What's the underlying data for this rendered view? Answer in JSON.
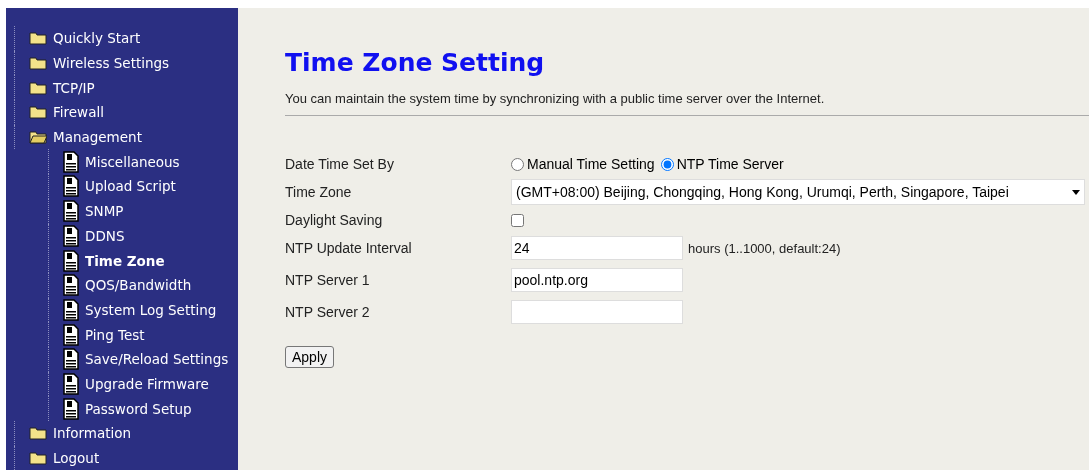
{
  "sidebar": {
    "items": [
      {
        "label": "Quickly Start",
        "kind": "folder",
        "selected": false
      },
      {
        "label": "Wireless Settings",
        "kind": "folder",
        "selected": false
      },
      {
        "label": "TCP/IP",
        "kind": "folder",
        "selected": false
      },
      {
        "label": "Firewall",
        "kind": "folder",
        "selected": false
      },
      {
        "label": "Management",
        "kind": "folder-open",
        "selected": false,
        "children": [
          {
            "label": "Miscellaneous",
            "kind": "page",
            "selected": false
          },
          {
            "label": "Upload Script",
            "kind": "page",
            "selected": false
          },
          {
            "label": "SNMP",
            "kind": "page",
            "selected": false
          },
          {
            "label": "DDNS",
            "kind": "page",
            "selected": false
          },
          {
            "label": "Time Zone",
            "kind": "page",
            "selected": true
          },
          {
            "label": "QOS/Bandwidth",
            "kind": "page",
            "selected": false
          },
          {
            "label": "System Log Setting",
            "kind": "page",
            "selected": false
          },
          {
            "label": "Ping Test",
            "kind": "page",
            "selected": false
          },
          {
            "label": "Save/Reload Settings",
            "kind": "page",
            "selected": false
          },
          {
            "label": "Upgrade Firmware",
            "kind": "page",
            "selected": false
          },
          {
            "label": "Password Setup",
            "kind": "page",
            "selected": false
          }
        ]
      },
      {
        "label": "Information",
        "kind": "folder",
        "selected": false
      },
      {
        "label": "Logout",
        "kind": "folder",
        "selected": false
      }
    ]
  },
  "page": {
    "title": "Time Zone Setting",
    "description": "You can maintain the system time by synchronizing with a public time server over the Internet."
  },
  "form": {
    "rows": [
      {
        "label": "Date Time Set By",
        "kind": "radio",
        "options": [
          {
            "label": "Manual Time Setting",
            "selected": false
          },
          {
            "label": "NTP Time Server",
            "selected": true
          }
        ]
      },
      {
        "label": "Time Zone",
        "kind": "select",
        "value": "(GMT+08:00) Beijing, Chongqing, Hong Kong, Urumqi, Perth, Singapore, Taipei"
      },
      {
        "label": "Daylight Saving",
        "kind": "checkbox",
        "checked": false
      },
      {
        "label": "NTP Update Interval",
        "kind": "input",
        "value": "24",
        "hint": "hours (1..1000, default:24)"
      },
      {
        "label": "NTP Server 1",
        "kind": "input",
        "value": "pool.ntp.org"
      },
      {
        "label": "NTP Server 2",
        "kind": "input",
        "value": ""
      }
    ]
  },
  "buttons": [
    "Apply"
  ]
}
